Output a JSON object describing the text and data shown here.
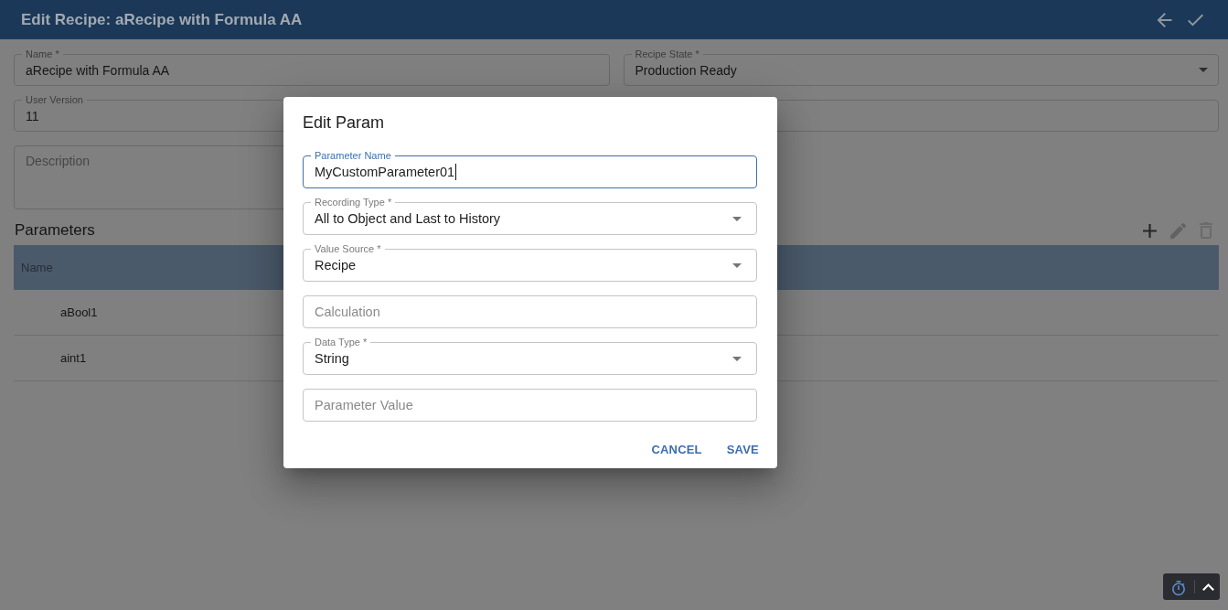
{
  "header": {
    "title": "Edit Recipe: aRecipe with Formula AA"
  },
  "form": {
    "fields": [
      {
        "kind": "text",
        "label": "Name *",
        "value": "aRecipe with Formula AA"
      },
      {
        "kind": "select",
        "label": "Recipe State *",
        "value": "Production Ready"
      },
      {
        "kind": "text",
        "label": "User Version",
        "value": "11"
      },
      {
        "kind": "text"
      },
      {
        "kind": "textarea",
        "placeholder": "Description"
      }
    ]
  },
  "parameters": {
    "title": "Parameters",
    "columns": [
      "Name"
    ],
    "rows": [
      {
        "name": "aBool1"
      },
      {
        "name": "aint1"
      }
    ]
  },
  "dialog": {
    "title": "Edit Param",
    "fields": [
      {
        "kind": "text",
        "label": "Parameter Name",
        "value": "MyCustomParameter01",
        "focused": true
      },
      {
        "kind": "select",
        "label": "Recording Type *",
        "value": "All to Object and Last to History",
        "focused": false
      },
      {
        "kind": "select",
        "label": "Value Source *",
        "value": "Recipe",
        "focused": false
      },
      {
        "kind": "text",
        "placeholder": "Calculation",
        "focused": false
      },
      {
        "kind": "select",
        "label": "Data Type *",
        "value": "String",
        "focused": false
      },
      {
        "kind": "text",
        "placeholder": "Parameter Value",
        "focused": false
      }
    ],
    "buttons": [
      "CANCEL",
      "SAVE"
    ]
  }
}
